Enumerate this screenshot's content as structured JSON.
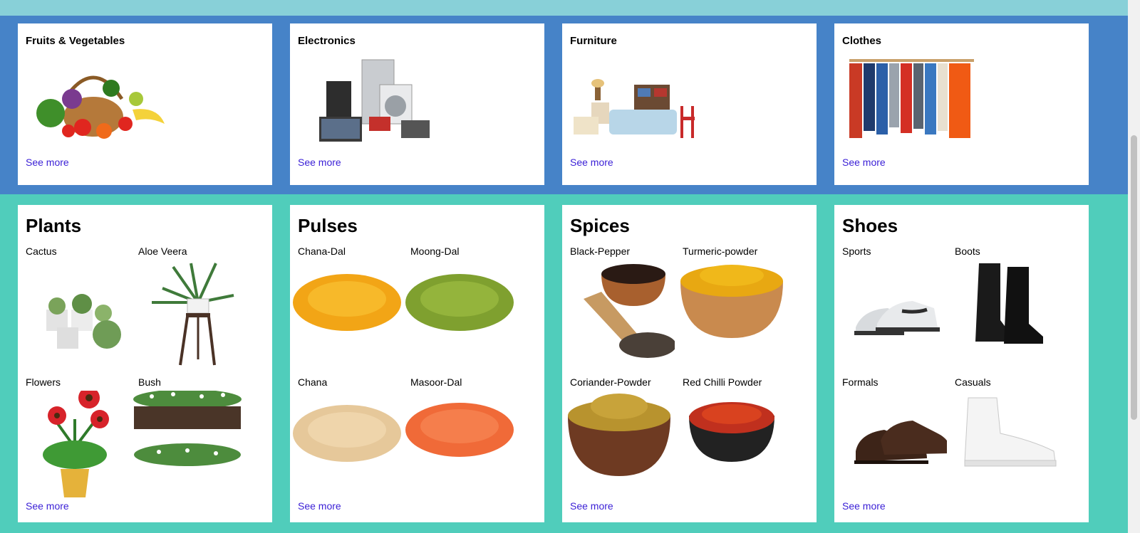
{
  "row1": [
    {
      "title": "Fruits & Vegetables",
      "icon": "fruit-basket-image",
      "see_more": "See more"
    },
    {
      "title": "Electronics",
      "icon": "appliances-image",
      "see_more": "See more"
    },
    {
      "title": "Furniture",
      "icon": "furniture-image",
      "see_more": "See more"
    },
    {
      "title": "Clothes",
      "icon": "clothes-rack-image",
      "see_more": "See more"
    }
  ],
  "row2": [
    {
      "title": "Plants",
      "see_more": "See more",
      "items": [
        {
          "label": "Cactus"
        },
        {
          "label": "Aloe Veera"
        },
        {
          "label": "Flowers"
        },
        {
          "label": "Bush"
        }
      ]
    },
    {
      "title": "Pulses",
      "see_more": "See more",
      "items": [
        {
          "label": "Chana-Dal"
        },
        {
          "label": "Moong-Dal"
        },
        {
          "label": "Chana"
        },
        {
          "label": "Masoor-Dal"
        }
      ]
    },
    {
      "title": "Spices",
      "see_more": "See more",
      "items": [
        {
          "label": "Black-Pepper"
        },
        {
          "label": "Turmeric-powder"
        },
        {
          "label": "Coriander-Powder"
        },
        {
          "label": "Red Chilli Powder"
        }
      ]
    },
    {
      "title": "Shoes",
      "see_more": "See more",
      "items": [
        {
          "label": "Sports"
        },
        {
          "label": "Boots"
        },
        {
          "label": "Formals"
        },
        {
          "label": "Casuals"
        }
      ]
    }
  ],
  "colors": {
    "blue_band": "#4683c8",
    "teal_band": "#50cdbb",
    "top_band": "#88d0d8",
    "link": "#3a1fd6"
  }
}
